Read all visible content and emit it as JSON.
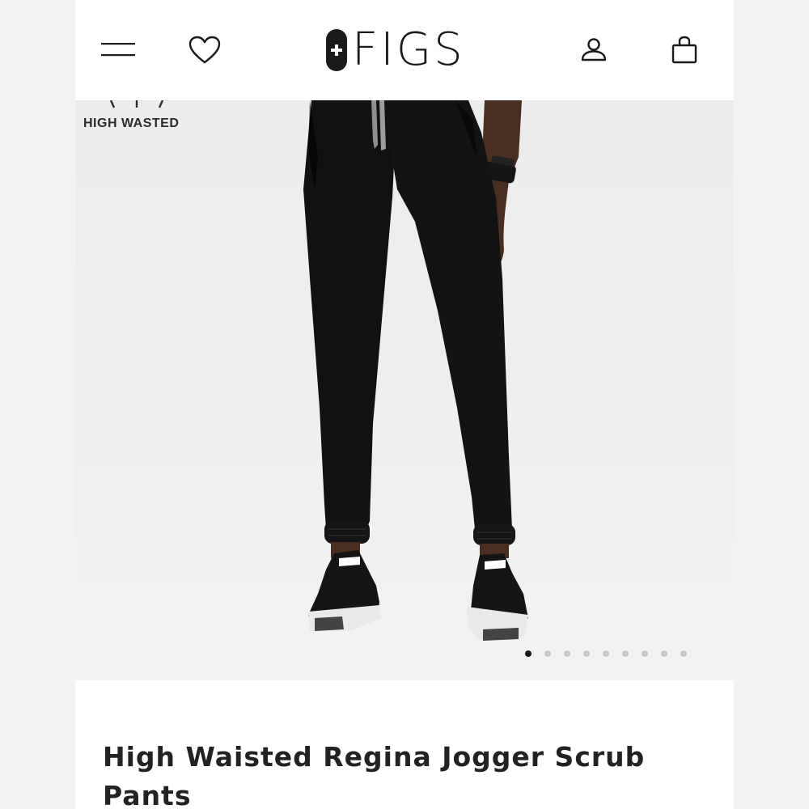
{
  "header": {
    "brand": "FIGS",
    "icons": {
      "menu": "hamburger-menu-icon",
      "wishlist": "heart-icon",
      "account": "user-icon",
      "cart": "shopping-bag-icon"
    }
  },
  "hero": {
    "badge_label": "HIGH WASTED",
    "carousel": {
      "total": 9,
      "active": 1
    },
    "colors": {
      "pants": "#111111",
      "drawstring": "#8e9090",
      "skin": "#4a2e22",
      "sneaker_sole": "#e9e9e9"
    }
  },
  "product": {
    "title": "High Waisted Regina Jogger Scrub Pants"
  }
}
